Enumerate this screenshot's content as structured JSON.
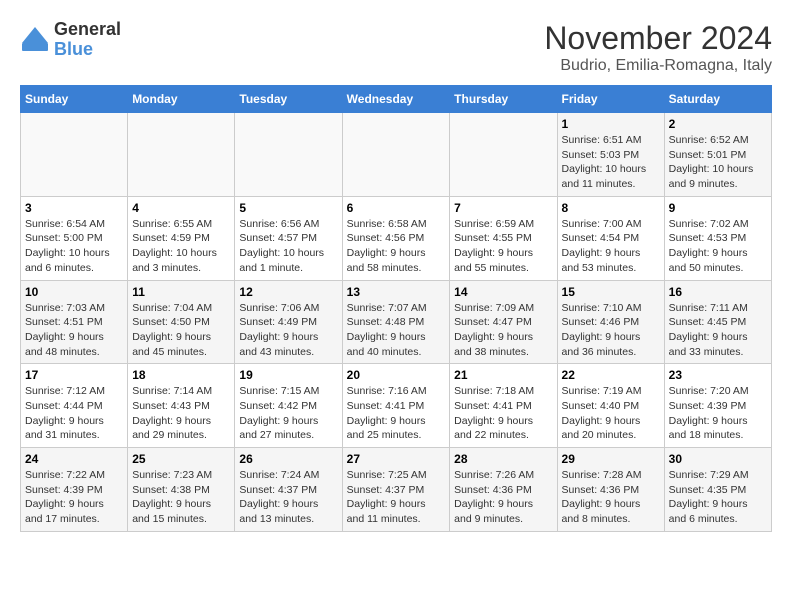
{
  "logo": {
    "general": "General",
    "blue": "Blue"
  },
  "title": {
    "month": "November 2024",
    "location": "Budrio, Emilia-Romagna, Italy"
  },
  "headers": [
    "Sunday",
    "Monday",
    "Tuesday",
    "Wednesday",
    "Thursday",
    "Friday",
    "Saturday"
  ],
  "weeks": [
    [
      {
        "day": "",
        "info": ""
      },
      {
        "day": "",
        "info": ""
      },
      {
        "day": "",
        "info": ""
      },
      {
        "day": "",
        "info": ""
      },
      {
        "day": "",
        "info": ""
      },
      {
        "day": "1",
        "info": "Sunrise: 6:51 AM\nSunset: 5:03 PM\nDaylight: 10 hours and 11 minutes."
      },
      {
        "day": "2",
        "info": "Sunrise: 6:52 AM\nSunset: 5:01 PM\nDaylight: 10 hours and 9 minutes."
      }
    ],
    [
      {
        "day": "3",
        "info": "Sunrise: 6:54 AM\nSunset: 5:00 PM\nDaylight: 10 hours and 6 minutes."
      },
      {
        "day": "4",
        "info": "Sunrise: 6:55 AM\nSunset: 4:59 PM\nDaylight: 10 hours and 3 minutes."
      },
      {
        "day": "5",
        "info": "Sunrise: 6:56 AM\nSunset: 4:57 PM\nDaylight: 10 hours and 1 minute."
      },
      {
        "day": "6",
        "info": "Sunrise: 6:58 AM\nSunset: 4:56 PM\nDaylight: 9 hours and 58 minutes."
      },
      {
        "day": "7",
        "info": "Sunrise: 6:59 AM\nSunset: 4:55 PM\nDaylight: 9 hours and 55 minutes."
      },
      {
        "day": "8",
        "info": "Sunrise: 7:00 AM\nSunset: 4:54 PM\nDaylight: 9 hours and 53 minutes."
      },
      {
        "day": "9",
        "info": "Sunrise: 7:02 AM\nSunset: 4:53 PM\nDaylight: 9 hours and 50 minutes."
      }
    ],
    [
      {
        "day": "10",
        "info": "Sunrise: 7:03 AM\nSunset: 4:51 PM\nDaylight: 9 hours and 48 minutes."
      },
      {
        "day": "11",
        "info": "Sunrise: 7:04 AM\nSunset: 4:50 PM\nDaylight: 9 hours and 45 minutes."
      },
      {
        "day": "12",
        "info": "Sunrise: 7:06 AM\nSunset: 4:49 PM\nDaylight: 9 hours and 43 minutes."
      },
      {
        "day": "13",
        "info": "Sunrise: 7:07 AM\nSunset: 4:48 PM\nDaylight: 9 hours and 40 minutes."
      },
      {
        "day": "14",
        "info": "Sunrise: 7:09 AM\nSunset: 4:47 PM\nDaylight: 9 hours and 38 minutes."
      },
      {
        "day": "15",
        "info": "Sunrise: 7:10 AM\nSunset: 4:46 PM\nDaylight: 9 hours and 36 minutes."
      },
      {
        "day": "16",
        "info": "Sunrise: 7:11 AM\nSunset: 4:45 PM\nDaylight: 9 hours and 33 minutes."
      }
    ],
    [
      {
        "day": "17",
        "info": "Sunrise: 7:12 AM\nSunset: 4:44 PM\nDaylight: 9 hours and 31 minutes."
      },
      {
        "day": "18",
        "info": "Sunrise: 7:14 AM\nSunset: 4:43 PM\nDaylight: 9 hours and 29 minutes."
      },
      {
        "day": "19",
        "info": "Sunrise: 7:15 AM\nSunset: 4:42 PM\nDaylight: 9 hours and 27 minutes."
      },
      {
        "day": "20",
        "info": "Sunrise: 7:16 AM\nSunset: 4:41 PM\nDaylight: 9 hours and 25 minutes."
      },
      {
        "day": "21",
        "info": "Sunrise: 7:18 AM\nSunset: 4:41 PM\nDaylight: 9 hours and 22 minutes."
      },
      {
        "day": "22",
        "info": "Sunrise: 7:19 AM\nSunset: 4:40 PM\nDaylight: 9 hours and 20 minutes."
      },
      {
        "day": "23",
        "info": "Sunrise: 7:20 AM\nSunset: 4:39 PM\nDaylight: 9 hours and 18 minutes."
      }
    ],
    [
      {
        "day": "24",
        "info": "Sunrise: 7:22 AM\nSunset: 4:39 PM\nDaylight: 9 hours and 17 minutes."
      },
      {
        "day": "25",
        "info": "Sunrise: 7:23 AM\nSunset: 4:38 PM\nDaylight: 9 hours and 15 minutes."
      },
      {
        "day": "26",
        "info": "Sunrise: 7:24 AM\nSunset: 4:37 PM\nDaylight: 9 hours and 13 minutes."
      },
      {
        "day": "27",
        "info": "Sunrise: 7:25 AM\nSunset: 4:37 PM\nDaylight: 9 hours and 11 minutes."
      },
      {
        "day": "28",
        "info": "Sunrise: 7:26 AM\nSunset: 4:36 PM\nDaylight: 9 hours and 9 minutes."
      },
      {
        "day": "29",
        "info": "Sunrise: 7:28 AM\nSunset: 4:36 PM\nDaylight: 9 hours and 8 minutes."
      },
      {
        "day": "30",
        "info": "Sunrise: 7:29 AM\nSunset: 4:35 PM\nDaylight: 9 hours and 6 minutes."
      }
    ]
  ]
}
